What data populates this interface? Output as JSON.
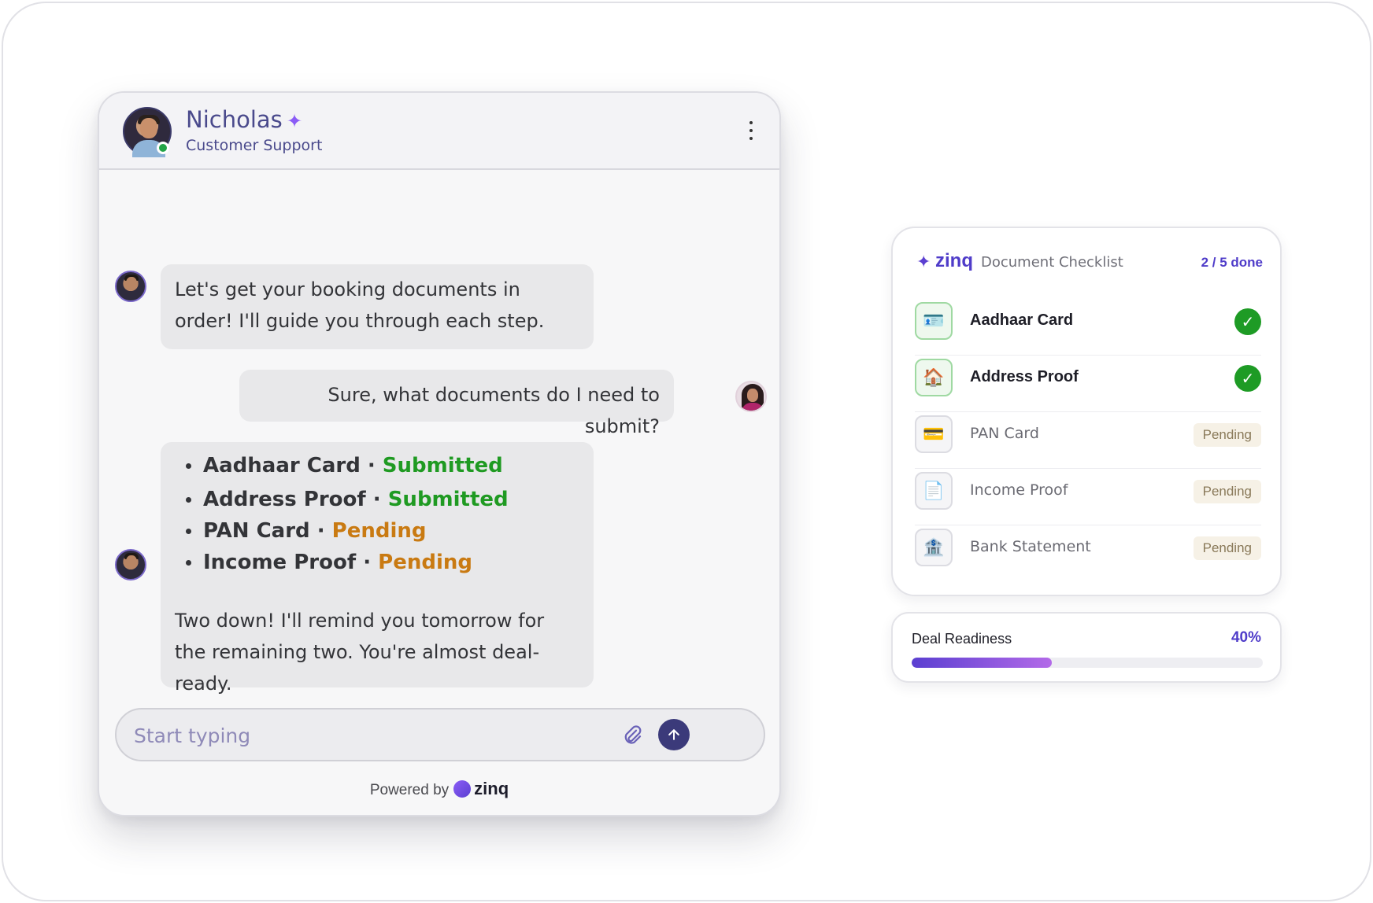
{
  "chat": {
    "agent_name": "Nicholas",
    "agent_role": "Customer Support",
    "messages": {
      "intro": "Let's get your booking documents in order! I'll guide you through each step.",
      "user_question": "Sure, what documents do I need to submit?",
      "summary_items": [
        {
          "name": "Aadhaar Card",
          "sep": " · ",
          "status": "Submitted"
        },
        {
          "name": "Address Proof",
          "sep": " · ",
          "status": "Submitted"
        },
        {
          "name": "PAN Card",
          "sep": " · ",
          "status": "Pending"
        },
        {
          "name": "Income Proof",
          "sep": " · ",
          "status": "Pending"
        }
      ],
      "closing": "Two down! I'll remind you tomorrow for the remaining two. You're almost deal-ready."
    },
    "input": {
      "placeholder": "Start typing",
      "value": ""
    },
    "powered_by": "Powered by",
    "brand": "zinq"
  },
  "checklist": {
    "brand": "zinq",
    "title": "Document Checklist",
    "count": "2 / 5 done",
    "items": [
      {
        "label": "Aadhaar Card",
        "status": "done",
        "icon": "id-card-icon"
      },
      {
        "label": "Address Proof",
        "status": "done",
        "icon": "house-icon"
      },
      {
        "label": "PAN Card",
        "status": "Pending",
        "icon": "card-icon"
      },
      {
        "label": "Income Proof",
        "status": "Pending",
        "icon": "document-icon"
      },
      {
        "label": "Bank Statement",
        "status": "Pending",
        "icon": "bank-icon"
      }
    ]
  },
  "deal": {
    "label": "Deal Readiness",
    "percent_label": "40%",
    "percent": 40
  },
  "colors": {
    "accent": "#4f3cc9",
    "submitted": "#1f9a22",
    "pending": "#c97a12",
    "check": "#1e9b25"
  }
}
